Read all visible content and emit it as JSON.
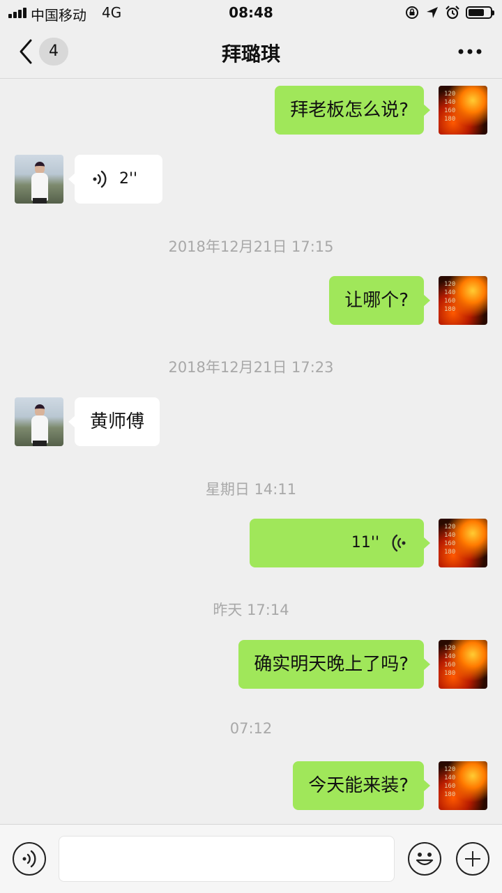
{
  "status_bar": {
    "carrier": "中国移动",
    "network": "4G",
    "time": "08:48",
    "icons": [
      "signal-icon",
      "rotation-lock-icon",
      "location-icon",
      "alarm-icon",
      "battery-icon"
    ],
    "battery_level": 0.65
  },
  "nav": {
    "back_icon": "chevron-left-icon",
    "unread_count": "4",
    "title": "拜璐琪",
    "more_icon": "more-dots-icon"
  },
  "messages": [
    {
      "side": "me",
      "type": "text",
      "text": "拜老板怎么说?"
    },
    {
      "side": "them",
      "type": "voice",
      "duration": "2''"
    },
    {
      "type": "timestamp",
      "text": "2018年12月21日 17:15"
    },
    {
      "side": "me",
      "type": "text",
      "text": "让哪个?"
    },
    {
      "type": "timestamp",
      "text": "2018年12月21日 17:23"
    },
    {
      "side": "them",
      "type": "text",
      "text": "黄师傅"
    },
    {
      "type": "timestamp",
      "text": "星期日 14:11"
    },
    {
      "side": "me",
      "type": "voice",
      "duration": "11''"
    },
    {
      "type": "timestamp",
      "text": "昨天 17:14"
    },
    {
      "side": "me",
      "type": "text",
      "text": "确实明天晚上了吗?"
    },
    {
      "type": "timestamp",
      "text": "07:12"
    },
    {
      "side": "me",
      "type": "text",
      "text": "今天能来装?"
    }
  ],
  "input_bar": {
    "voice_icon": "voice-input-icon",
    "text_value": "",
    "emoji_icon": "emoji-icon",
    "plus_icon": "plus-icon"
  },
  "colors": {
    "background": "#efefef",
    "my_bubble": "#a0e75a",
    "their_bubble": "#ffffff",
    "timestamp_text": "#a8a8a8"
  }
}
